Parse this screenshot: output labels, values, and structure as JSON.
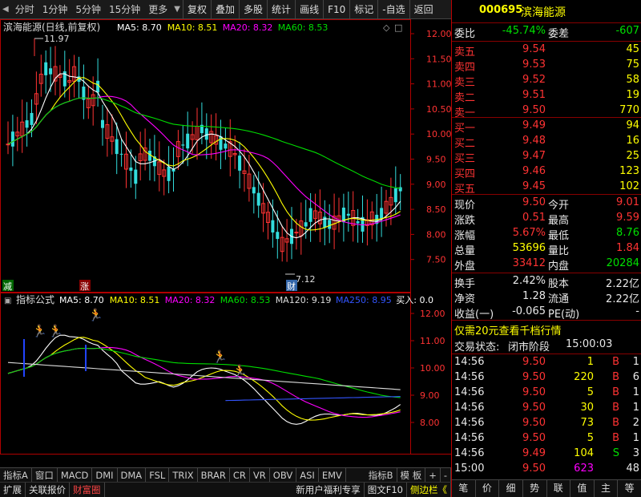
{
  "toolbar": {
    "tabs": [
      "分时",
      "1分钟",
      "5分钟",
      "15分钟",
      "更多"
    ],
    "buttons": [
      "复权",
      "叠加",
      "多股",
      "统计",
      "画线",
      "F10",
      "标记",
      "-自选",
      "返回"
    ]
  },
  "main_chart": {
    "title": "滨海能源(日线,前复权)",
    "ma_labels": [
      {
        "text": "MA5: 8.70",
        "color": "#ffffff"
      },
      {
        "text": "MA10: 8.51",
        "color": "#ffff00"
      },
      {
        "text": "MA20: 8.32",
        "color": "#ff00ff"
      },
      {
        "text": "MA60: 8.53",
        "color": "#00dd00"
      }
    ],
    "y_ticks": [
      "12.00",
      "11.50",
      "11.00",
      "10.50",
      "10.00",
      "9.50",
      "9.00",
      "8.50",
      "8.00",
      "7.50"
    ],
    "high_label": "11.97",
    "low_label": "7.12",
    "marker_left": "减",
    "marker_mid": "涨",
    "marker_right": "财"
  },
  "sub_chart": {
    "title": "指标公式",
    "ma_labels": [
      {
        "text": "MA5: 8.70",
        "color": "#ffffff"
      },
      {
        "text": "MA10: 8.51",
        "color": "#ffff00"
      },
      {
        "text": "MA20: 8.32",
        "color": "#ff00ff"
      },
      {
        "text": "MA60: 8.53",
        "color": "#00dd00"
      },
      {
        "text": "MA120: 9.19",
        "color": "#dddddd"
      },
      {
        "text": "MA250: 8.95",
        "color": "#3355ff"
      },
      {
        "text": "买入: 0.0",
        "color": "#ffffff"
      }
    ],
    "y_ticks": [
      "12.00",
      "11.00",
      "10.00",
      "9.00",
      "8.00"
    ]
  },
  "x_axis": {
    "labels": [
      "2021年",
      "2",
      "3",
      "4",
      "5",
      "6"
    ],
    "right_label": "日线"
  },
  "indicator_tabs": [
    "指标A",
    "窗口",
    "MACD",
    "DMI",
    "DMA",
    "FSL",
    "TRIX",
    "BRAR",
    "CR",
    "VR",
    "OBV",
    "ASI",
    "EMV"
  ],
  "indicator_tabs_right": [
    "指标B",
    "模 板",
    "+",
    "-"
  ],
  "status_left": [
    "扩展",
    "关联报价",
    "财富圈"
  ],
  "status_right": [
    "新用户福利专享",
    "图文F10",
    "侧边栏《"
  ],
  "quote": {
    "code": "000695",
    "name": "滨海能源",
    "weibi_label": "委比",
    "weibi": "-45.74%",
    "weicha_label": "委差",
    "weicha": "-607",
    "asks": [
      {
        "label": "卖五",
        "price": "9.54",
        "vol": "45"
      },
      {
        "label": "卖四",
        "price": "9.53",
        "vol": "75"
      },
      {
        "label": "卖三",
        "price": "9.52",
        "vol": "58"
      },
      {
        "label": "卖二",
        "price": "9.51",
        "vol": "19"
      },
      {
        "label": "卖一",
        "price": "9.50",
        "vol": "770"
      }
    ],
    "bids": [
      {
        "label": "买一",
        "price": "9.49",
        "vol": "94"
      },
      {
        "label": "买二",
        "price": "9.48",
        "vol": "16"
      },
      {
        "label": "买三",
        "price": "9.47",
        "vol": "25"
      },
      {
        "label": "买四",
        "price": "9.46",
        "vol": "123"
      },
      {
        "label": "买五",
        "price": "9.45",
        "vol": "102"
      }
    ],
    "stats": [
      {
        "l1": "现价",
        "v1": "9.50",
        "c1": "red",
        "l2": "今开",
        "v2": "9.01",
        "c2": "red"
      },
      {
        "l1": "涨跌",
        "v1": "0.51",
        "c1": "red",
        "l2": "最高",
        "v2": "9.59",
        "c2": "red"
      },
      {
        "l1": "涨幅",
        "v1": "5.67%",
        "c1": "red",
        "l2": "最低",
        "v2": "8.76",
        "c2": "grn"
      },
      {
        "l1": "总量",
        "v1": "53696",
        "c1": "yel",
        "l2": "量比",
        "v2": "1.84",
        "c2": "red"
      },
      {
        "l1": "外盘",
        "v1": "33412",
        "c1": "red",
        "l2": "内盘",
        "v2": "20284",
        "c2": "grn"
      }
    ],
    "stats2": [
      {
        "l1": "换手",
        "v1": "2.42%",
        "l2": "股本",
        "v2": "2.22亿"
      },
      {
        "l1": "净资",
        "v1": "1.28",
        "l2": "流通",
        "v2": "2.22亿"
      },
      {
        "l1": "收益(一)",
        "v1": "-0.065",
        "l2": "PE(动)",
        "v2": "-"
      }
    ],
    "promo": "仅需20元查看千档行情",
    "trade_state_label": "交易状态:",
    "trade_state": "闭市阶段",
    "trade_time": "15:00:03",
    "ticks": [
      {
        "t": "14:56",
        "p": "9.50",
        "v": "1",
        "bs": "B",
        "n": "1",
        "vc": "yel",
        "bc": "red"
      },
      {
        "t": "14:56",
        "p": "9.50",
        "v": "220",
        "bs": "B",
        "n": "6",
        "vc": "yel",
        "bc": "red"
      },
      {
        "t": "14:56",
        "p": "9.50",
        "v": "5",
        "bs": "B",
        "n": "1",
        "vc": "yel",
        "bc": "red"
      },
      {
        "t": "14:56",
        "p": "9.50",
        "v": "30",
        "bs": "B",
        "n": "1",
        "vc": "yel",
        "bc": "red"
      },
      {
        "t": "14:56",
        "p": "9.50",
        "v": "73",
        "bs": "B",
        "n": "2",
        "vc": "yel",
        "bc": "red"
      },
      {
        "t": "14:56",
        "p": "9.50",
        "v": "5",
        "bs": "B",
        "n": "1",
        "vc": "yel",
        "bc": "red"
      },
      {
        "t": "14:56",
        "p": "9.49",
        "v": "104",
        "bs": "S",
        "n": "3",
        "vc": "yel",
        "bc": "grn"
      },
      {
        "t": "15:00",
        "p": "9.50",
        "v": "623",
        "bs": "",
        "n": "48",
        "vc": "mag",
        "bc": "red"
      }
    ],
    "bottom_tabs": [
      "笔",
      "价",
      "细",
      "势",
      "联",
      "值",
      "主",
      "等"
    ]
  }
}
